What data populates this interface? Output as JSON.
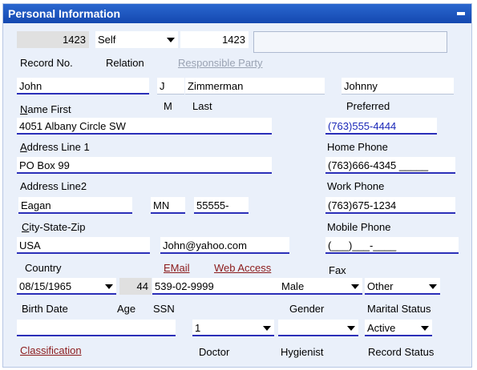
{
  "title": "Personal Information",
  "record_no": "1423",
  "relation": "Self",
  "responsible_party_no": "1423",
  "responsible_party_name": "",
  "labels": {
    "record_no": "Record No.",
    "relation": "Relation",
    "responsible_party": "Responsible Party",
    "name_first": "Name First",
    "m": "M",
    "last": "Last",
    "preferred": "Preferred",
    "address1": "Address Line 1",
    "home_phone": "Home Phone",
    "address2": "Address Line2",
    "work_phone": "Work Phone",
    "city_state_zip": "City-State-Zip",
    "mobile_phone": "Mobile Phone",
    "country": "Country",
    "email": "EMail",
    "web_access": "Web Access",
    "fax": "Fax",
    "birth_date": "Birth Date",
    "age": "Age",
    "ssn": "SSN",
    "gender": "Gender",
    "marital_status": "Marital Status",
    "classification": "Classification",
    "doctor": "Doctor",
    "hygienist": "Hygienist",
    "record_status": "Record Status"
  },
  "values": {
    "first": "John",
    "middle": "J",
    "last": "Zimmerman",
    "preferred": "Johnny",
    "address1": "4051 Albany Circle SW",
    "home_phone": "(763)555-4444",
    "address2": "PO Box 99",
    "work_phone": "(763)666-4345 _____",
    "city": "Eagan",
    "state": "MN",
    "zip": "55555-",
    "mobile_phone": "(763)675-1234",
    "country": "USA",
    "email": "John@yahoo.com",
    "fax": "(___)___-____",
    "birth_date": "08/15/1965",
    "age": "44",
    "ssn": "539-02-9999",
    "gender": "Male",
    "marital_status": "Other",
    "classification": "",
    "doctor": "1",
    "hygienist": "",
    "record_status": "Active"
  }
}
